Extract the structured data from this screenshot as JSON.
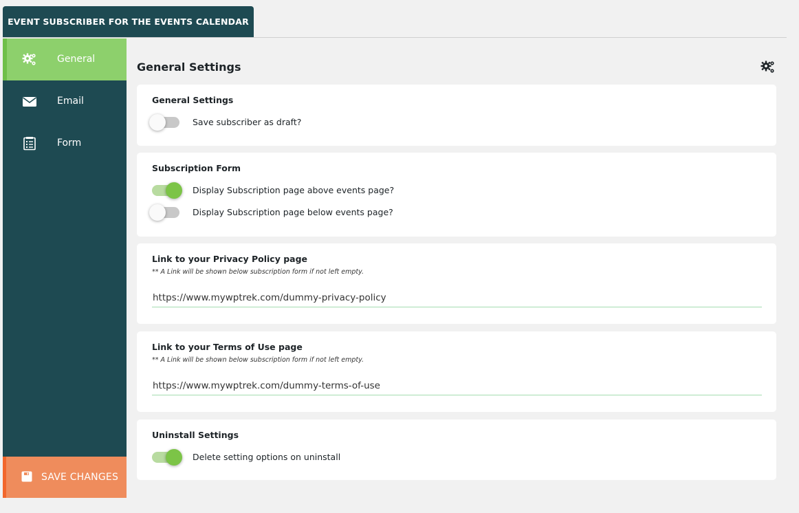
{
  "header": {
    "title": "EVENT SUBSCRIBER FOR THE EVENTS CALENDAR"
  },
  "sidebar": {
    "items": [
      {
        "label": "General",
        "icon": "gears-icon",
        "active": true
      },
      {
        "label": "Email",
        "icon": "envelope-icon",
        "active": false
      },
      {
        "label": "Form",
        "icon": "form-icon",
        "active": false
      }
    ],
    "save_label": "SAVE CHANGES"
  },
  "main": {
    "title": "General Settings",
    "general": {
      "title": "General Settings",
      "draft_label": "Save subscriber as draft?",
      "draft_on": false
    },
    "subscription": {
      "title": "Subscription Form",
      "above_label": "Display Subscription page above events page?",
      "above_on": true,
      "below_label": "Display Subscription page below events page?",
      "below_on": false
    },
    "privacy": {
      "title": "Link to your Privacy Policy page",
      "note": "** A Link will be shown below subscription form if not left empty.",
      "value": "https://www.mywptrek.com/dummy-privacy-policy"
    },
    "terms": {
      "title": "Link to your Terms of Use page",
      "note": "** A Link will be shown below subscription form if not left empty.",
      "value": "https://www.mywptrek.com/dummy-terms-of-use"
    },
    "uninstall": {
      "title": "Uninstall Settings",
      "delete_label": "Delete setting options on uninstall",
      "delete_on": true
    }
  },
  "colors": {
    "sidebar_bg": "#1e4a52",
    "active_item": "#8dd06c",
    "save_button": "#ef8c5c",
    "toggle_on": "#7cc447"
  }
}
